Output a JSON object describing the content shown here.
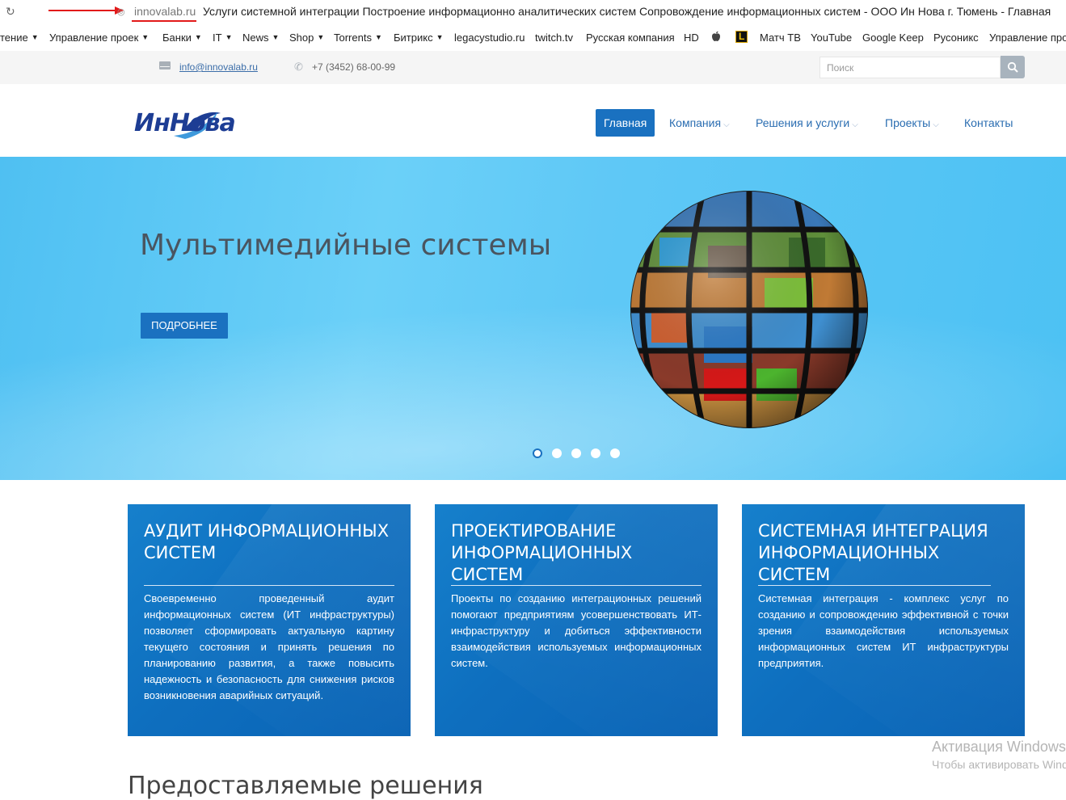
{
  "browser": {
    "domain": "innovalab.ru",
    "page_title": "Услуги системной интеграции Построение информационно аналитических систем Сопровождение информационных систем - ООО Ин Нова г. Тюмень - Главная"
  },
  "bookmarks": [
    {
      "label": "тение",
      "caret": "▼"
    },
    {
      "label": "Управление проек",
      "caret": "▼"
    },
    {
      "label": "Банки",
      "caret": "▼"
    },
    {
      "label": "IT",
      "caret": "▼"
    },
    {
      "label": "News",
      "caret": "▼"
    },
    {
      "label": "Shop",
      "caret": "▼"
    },
    {
      "label": "Torrents",
      "caret": "▼"
    },
    {
      "label": "Битрикс",
      "caret": "▼"
    },
    {
      "label": "legacystudio.ru",
      "caret": ""
    },
    {
      "label": "twitch.tv",
      "caret": ""
    },
    {
      "label": "Русская компания",
      "caret": ""
    },
    {
      "label": "HD",
      "caret": ""
    },
    {
      "label": "Матч ТВ",
      "caret": ""
    },
    {
      "label": "YouTube",
      "caret": ""
    },
    {
      "label": "Google Keep",
      "caret": ""
    },
    {
      "label": "Русоникс",
      "caret": ""
    },
    {
      "label": "Управление про",
      "caret": ""
    }
  ],
  "contact": {
    "email": "info@innovalab.ru",
    "phone": "+7 (3452) 68-00-99"
  },
  "search": {
    "placeholder": "Поиск"
  },
  "logo": {
    "text": "ИнНова"
  },
  "nav": {
    "home": "Главная",
    "company": "Компания",
    "solutions": "Решения и услуги",
    "projects": "Проекты",
    "contacts": "Контакты",
    "chevron": "⌵"
  },
  "hero": {
    "title": "Мультимедийные системы",
    "button": "ПОДРОБНЕЕ",
    "slides_total": 5,
    "active_slide": 1
  },
  "cards": [
    {
      "title": "АУДИТ ИНФОРМАЦИОННЫХ СИСТЕМ",
      "text": "Своевременно проведенный аудит информационных систем (ИТ инфраструктуры) позволяет сформировать актуальную картину текущего состояния и принять решения по планированию развития, а также повысить надежность и безопасность для снижения рисков возникновения аварийных ситуаций."
    },
    {
      "title": "ПРОЕКТИРОВАНИЕ ИНФОРМАЦИОННЫХ СИСТЕМ",
      "text": "Проекты по созданию интеграционных решений помогают предприятиям усовершенствовать ИТ-инфраструктуру и добиться эффективности взаимодействия используемых информационных систем."
    },
    {
      "title": "СИСТЕМНАЯ ИНТЕГРАЦИЯ ИНФОРМАЦИОННЫХ СИСТЕМ",
      "text": "Системная интеграция - комплекс услуг по созданию и сопровождению эффективной с точки зрения взаимодействия используемых информационных систем ИТ инфраструктуры предприятия."
    }
  ],
  "section": {
    "title": "Предоставляемые решения"
  },
  "watermark": {
    "line1": "Активация Windows",
    "line2": "Чтобы активировать Windows"
  },
  "colors": {
    "primary": "#1a71c0",
    "link": "#2a6db1",
    "hero_bg": "#5fc8f6",
    "card_bg": "#0e6fbf"
  }
}
